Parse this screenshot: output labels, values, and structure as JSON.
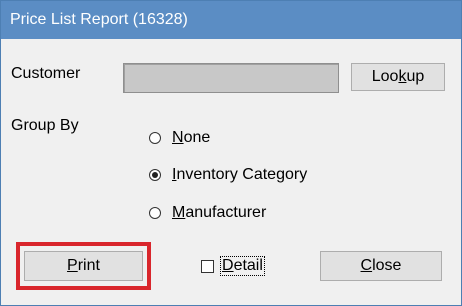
{
  "window": {
    "title": "Price List Report (16328)"
  },
  "customer": {
    "label": "Customer",
    "value": "",
    "lookup_prefix": "Loo",
    "lookup_mnemonic": "k",
    "lookup_suffix": "up"
  },
  "group_by": {
    "label": "Group By",
    "options": [
      {
        "mnemonic": "N",
        "rest": "one",
        "selected": false
      },
      {
        "mnemonic": "I",
        "rest": "nventory Category",
        "selected": true
      },
      {
        "mnemonic": "M",
        "rest": "anufacturer",
        "selected": false
      }
    ]
  },
  "actions": {
    "print_mnemonic": "P",
    "print_rest": "rint",
    "detail_mnemonic": "D",
    "detail_rest": "etail",
    "detail_checked": false,
    "close_mnemonic": "C",
    "close_rest": "lose"
  },
  "colors": {
    "titlebar": "#5b8dc4",
    "highlight": "#d9262c"
  }
}
